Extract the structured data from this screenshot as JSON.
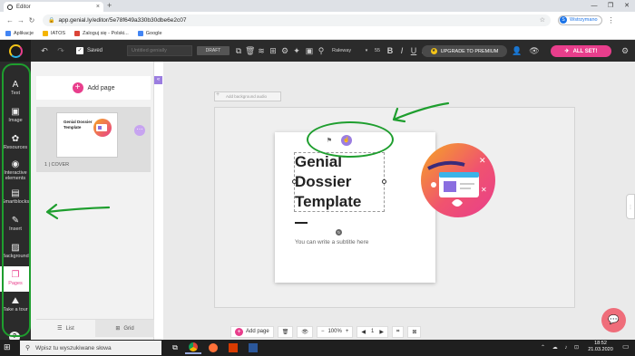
{
  "browser": {
    "tab_title": "Editor",
    "new_tab": "+",
    "tab_close": "×",
    "url": "app.genial.ly/editor/5e78f649a330b30dbe6e2c07",
    "profile": "Wstrzymano",
    "profile_initial": "S",
    "window_controls": [
      "—",
      "❐",
      "✕"
    ],
    "bookmarks": [
      {
        "label": "Aplikacje",
        "color": "#4285f4"
      },
      {
        "label": "IATOS",
        "color": "#f4b400"
      },
      {
        "label": "Zaloguj się - Polski...",
        "color": "#db4437"
      },
      {
        "label": "Google",
        "color": "#4285f4"
      }
    ]
  },
  "toolbar": {
    "saved_label": "Saved",
    "title_placeholder": "Untitled genially",
    "draft_label": "DRAFT",
    "font_name": "Raleway",
    "font_size": "55",
    "upgrade_label": "UPGRADE TO PREMIUM",
    "allset_label": "ALL SET!"
  },
  "sidebar": {
    "items": [
      {
        "label": "Text",
        "icon": "A"
      },
      {
        "label": "Image",
        "icon": "▣"
      },
      {
        "label": "Resources",
        "icon": "✿"
      },
      {
        "label": "Interactive elements",
        "icon": "◉"
      },
      {
        "label": "Smartblocks",
        "icon": "▤"
      },
      {
        "label": "Insert",
        "icon": "✎"
      },
      {
        "label": "Background",
        "icon": "▨"
      },
      {
        "label": "Pages",
        "icon": "❐"
      },
      {
        "label": "Take a tour",
        "icon": "⛰"
      }
    ],
    "help": "?"
  },
  "pages_panel": {
    "add_page_label": "Add page",
    "thumb_title": "Genial Dossier Template",
    "cover_label": "1 | COVER",
    "list_label": "List",
    "grid_label": "Grid"
  },
  "canvas": {
    "bg_audio_label": "Add background audio",
    "title": "Genial Dossier Template",
    "subtitle": "You can write a subtitle here"
  },
  "bottom_bar": {
    "add_page_label": "Add page",
    "zoom": "100%",
    "page_number": "1"
  },
  "taskbar": {
    "search_placeholder": "Wpisz tu wyszukiwane słowa",
    "time": "18:52",
    "date": "21.03.2020"
  },
  "colors": {
    "accent": "#e83e8c",
    "purple": "#9b7de0",
    "annotation_green": "#1e9e2e",
    "toolbar_dark": "#2b2b2b"
  }
}
